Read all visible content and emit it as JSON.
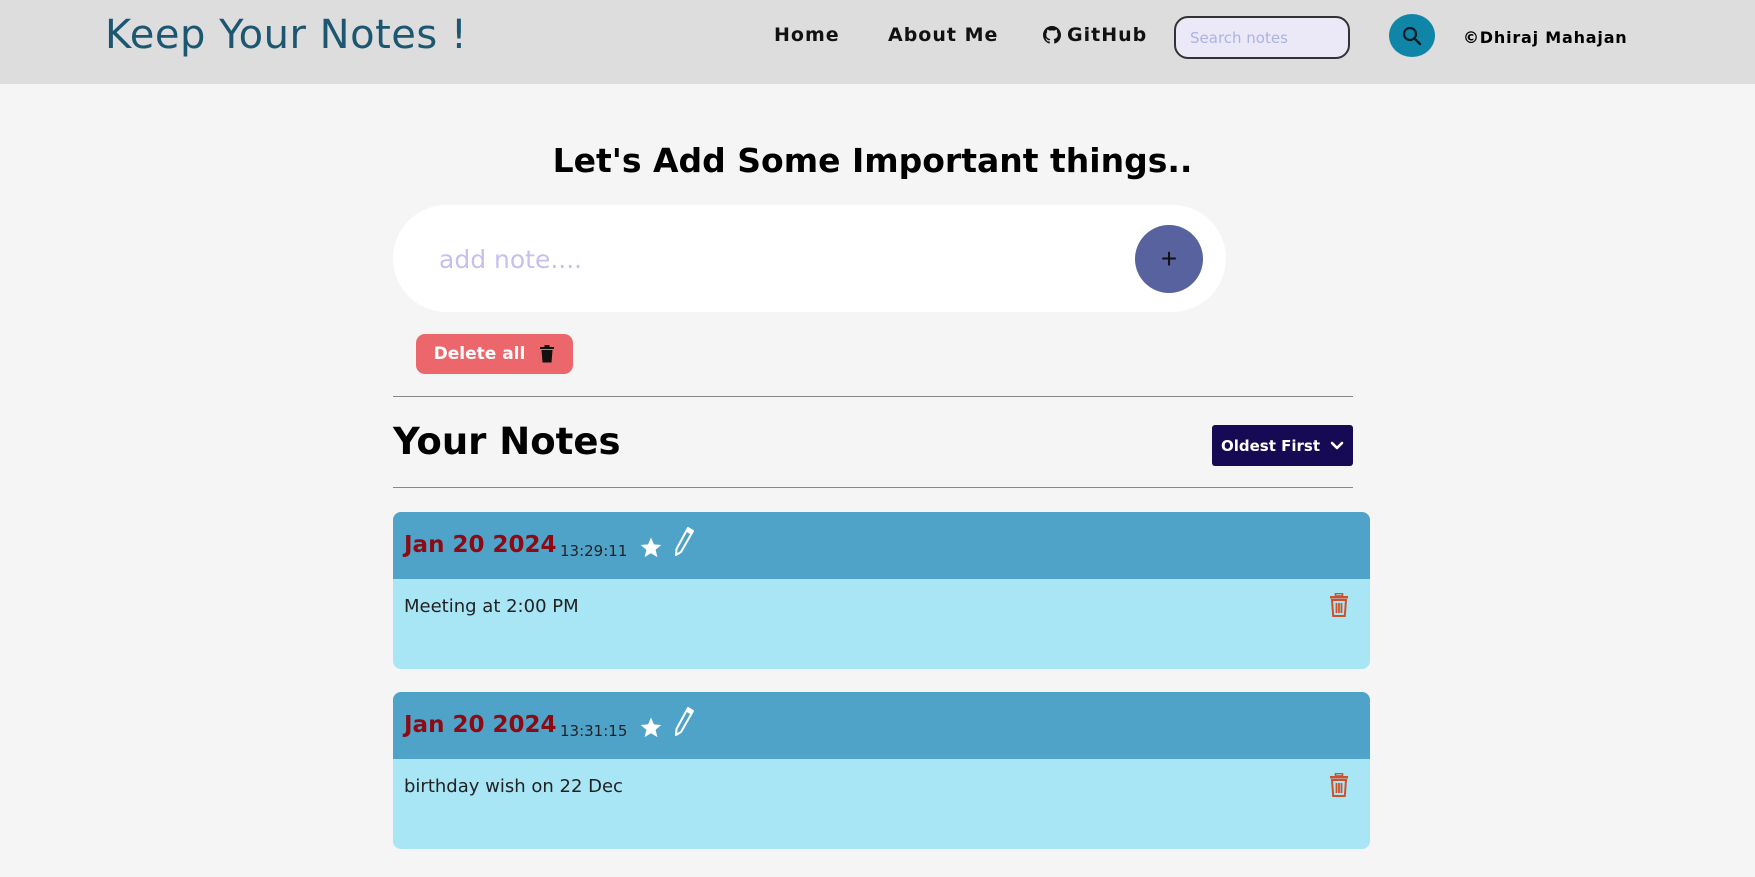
{
  "navbar": {
    "brand": "Keep Your Notes !",
    "links": {
      "home": "Home",
      "about": "About Me",
      "github": "GitHub"
    },
    "search_placeholder": "Search notes",
    "copyright": "©Dhiraj Mahajan"
  },
  "main": {
    "headline": "Let's Add Some Important things..",
    "add_placeholder": "add note....",
    "add_button": "+",
    "delete_all": "Delete all"
  },
  "notes_section": {
    "title": "Your Notes",
    "sort_selected": "Oldest First"
  },
  "notes": [
    {
      "date": "Jan 20 2024",
      "time": "13:29:11",
      "text": "Meeting at 2:00 PM"
    },
    {
      "date": "Jan 20 2024",
      "time": "13:31:15",
      "text": "birthday wish on 22 Dec"
    }
  ],
  "icons": {
    "search": "search-icon",
    "github": "github-icon",
    "trash": "trash-icon",
    "chevron": "chevron-down-icon",
    "star": "star-icon",
    "pencil": "pencil-icon"
  },
  "colors": {
    "navbar_bg": "#dddddd",
    "brand": "#1d5670",
    "search_button": "#0f86a7",
    "add_button": "#58629e",
    "delete_all": "#ec676b",
    "sort_select": "#170a55",
    "note_header": "#50a3c8",
    "note_body": "#a8e5f5",
    "note_date": "#8b0a14",
    "note_delete": "#d0502a"
  }
}
